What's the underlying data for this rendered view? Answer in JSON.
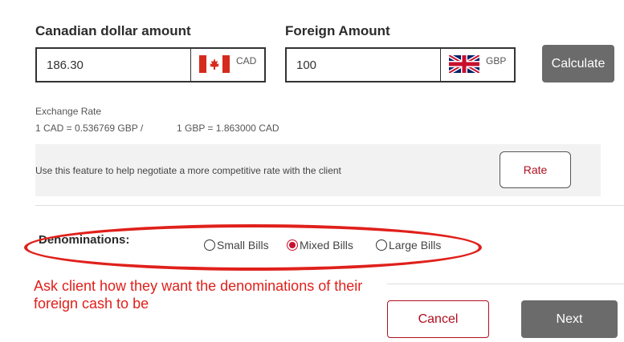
{
  "cad_field": {
    "label": "Canadian dollar amount",
    "value": "186.30",
    "currency": "CAD",
    "flag": "canada-flag-icon"
  },
  "foreign_field": {
    "label": "Foreign Amount",
    "value": "100",
    "currency": "GBP",
    "flag": "uk-flag-icon"
  },
  "calculate_label": "Calculate",
  "exchange": {
    "label": "Exchange Rate",
    "cad_to_gbp": "1 CAD = 0.536769 GBP /",
    "gbp_to_cad": "1 GBP = 1.863000 CAD"
  },
  "rate_panel": {
    "message": "Use this feature to help negotiate a more competitive rate with the client",
    "button": "Rate"
  },
  "denominations": {
    "label": "Denominations:",
    "options": [
      "Small Bills",
      "Mixed Bills",
      "Large Bills"
    ],
    "selected": "Mixed Bills"
  },
  "annotation": {
    "text": "Ask client how they want the denominations of their foreign cash to be",
    "color": "#e0201b"
  },
  "actions": {
    "cancel": "Cancel",
    "next": "Next"
  },
  "colors": {
    "brand_red": "#b10e1e",
    "button_gray": "#6b6b6b"
  }
}
